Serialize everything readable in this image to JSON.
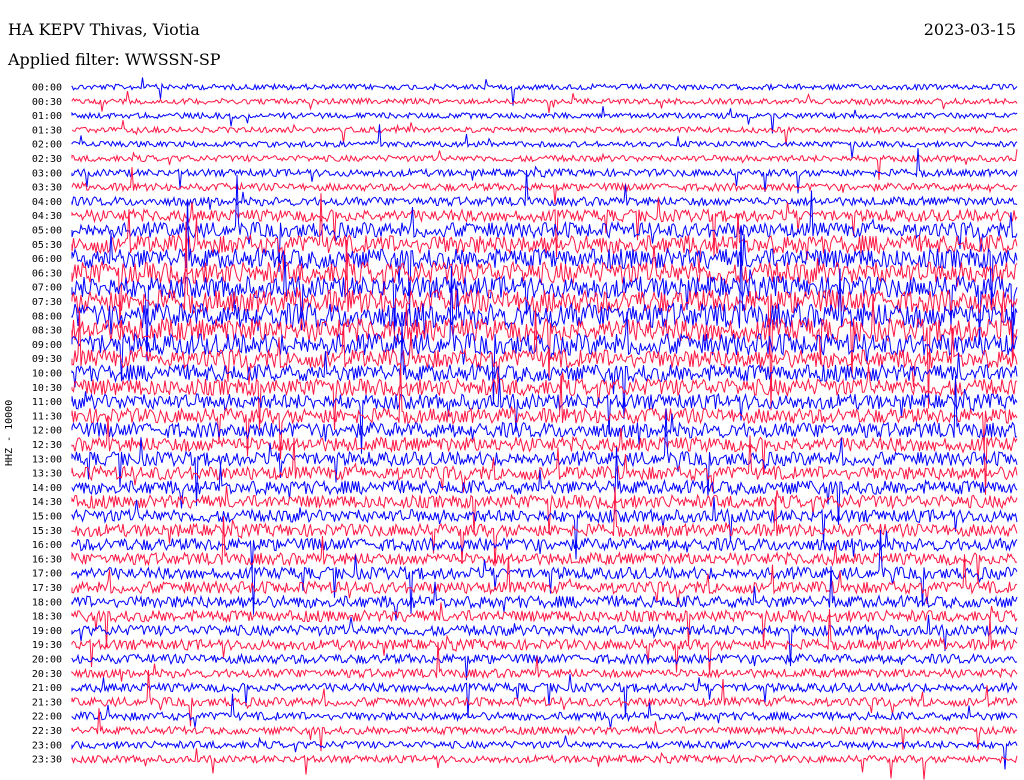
{
  "header": {
    "station": "HA KEPV Thivas, Viotia",
    "date": "2023-03-15",
    "filter": "Applied filter: WWSSN-SP"
  },
  "chart_data": {
    "type": "line",
    "title": "HA KEPV Thivas, Viotia",
    "subtitle": "Applied filter: WWSSN-SP",
    "ylabel": "HHZ - 10000",
    "row_times": [
      "00:00",
      "00:30",
      "01:00",
      "01:30",
      "02:00",
      "02:30",
      "03:00",
      "03:30",
      "04:00",
      "04:30",
      "05:00",
      "05:30",
      "06:00",
      "06:30",
      "07:00",
      "07:30",
      "08:00",
      "08:30",
      "09:00",
      "09:30",
      "10:00",
      "10:30",
      "11:00",
      "11:30",
      "12:00",
      "12:30",
      "13:00",
      "13:30",
      "14:00",
      "14:30",
      "15:00",
      "15:30",
      "16:00",
      "16:30",
      "17:00",
      "17:30",
      "18:00",
      "18:30",
      "19:00",
      "19:30",
      "20:00",
      "20:30",
      "21:00",
      "21:30",
      "22:00",
      "22:30",
      "23:00",
      "23:30"
    ],
    "row_colors": [
      "#0000ff",
      "#ff1744"
    ],
    "relative_noise_level": [
      1,
      1,
      1,
      1,
      1,
      1.2,
      1.5,
      1.6,
      2,
      3,
      4,
      5,
      5.5,
      6,
      6,
      6.5,
      7,
      6.5,
      6,
      5,
      4.5,
      4.5,
      4,
      4,
      4,
      3.8,
      3.6,
      3.5,
      3.5,
      3.3,
      3.2,
      3.2,
      3.2,
      3,
      3,
      3,
      3,
      2.8,
      2.5,
      2.5,
      2.2,
      2,
      2,
      2,
      1.8,
      1.6,
      1.5,
      1.5
    ],
    "grid": false
  }
}
